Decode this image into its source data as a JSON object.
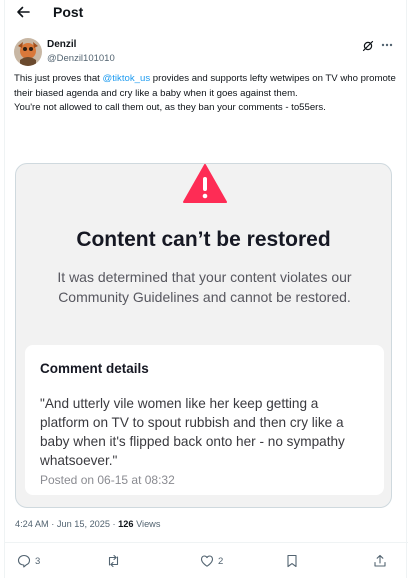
{
  "header": {
    "title": "Post"
  },
  "post": {
    "author_name": "Denzil",
    "author_handle": "@Denzil101010",
    "text_line1_pre": "This just proves that ",
    "mention": "@tiktok_us",
    "text_line1_post": " provides and supports lefty wetwipes on TV who promote their biased agenda and cry like a baby when it goes against them.",
    "text_line2": "You're not allowed to call them out, as they ban your comments - to55ers.",
    "timestamp": "4:24 AM · Jun 15, 2025 · ",
    "views_count": "126",
    "views_label": " Views"
  },
  "card": {
    "title": "Content can’t be restored",
    "description": "It was determined that your content violates our Community Guidelines and cannot be restored.",
    "details_heading": "Comment details",
    "quote": "\"And utterly vile women like her keep getting a platform on TV to spout rubbish and then cry like a baby when it's flipped back onto her - no sympathy whatsoever.\"",
    "posted": "Posted on 06-15 at 08:32"
  },
  "actions": {
    "replies": "3",
    "reposts": "",
    "likes": "2"
  },
  "colors": {
    "accent": "#1d9bf0",
    "warning": "#fe2c55",
    "text": "#0f1419",
    "muted": "#536471"
  },
  "icons": [
    "back-arrow-icon",
    "grok-icon",
    "more-icon",
    "warning-icon",
    "reply-icon",
    "repost-icon",
    "like-icon",
    "bookmark-icon",
    "share-icon"
  ]
}
